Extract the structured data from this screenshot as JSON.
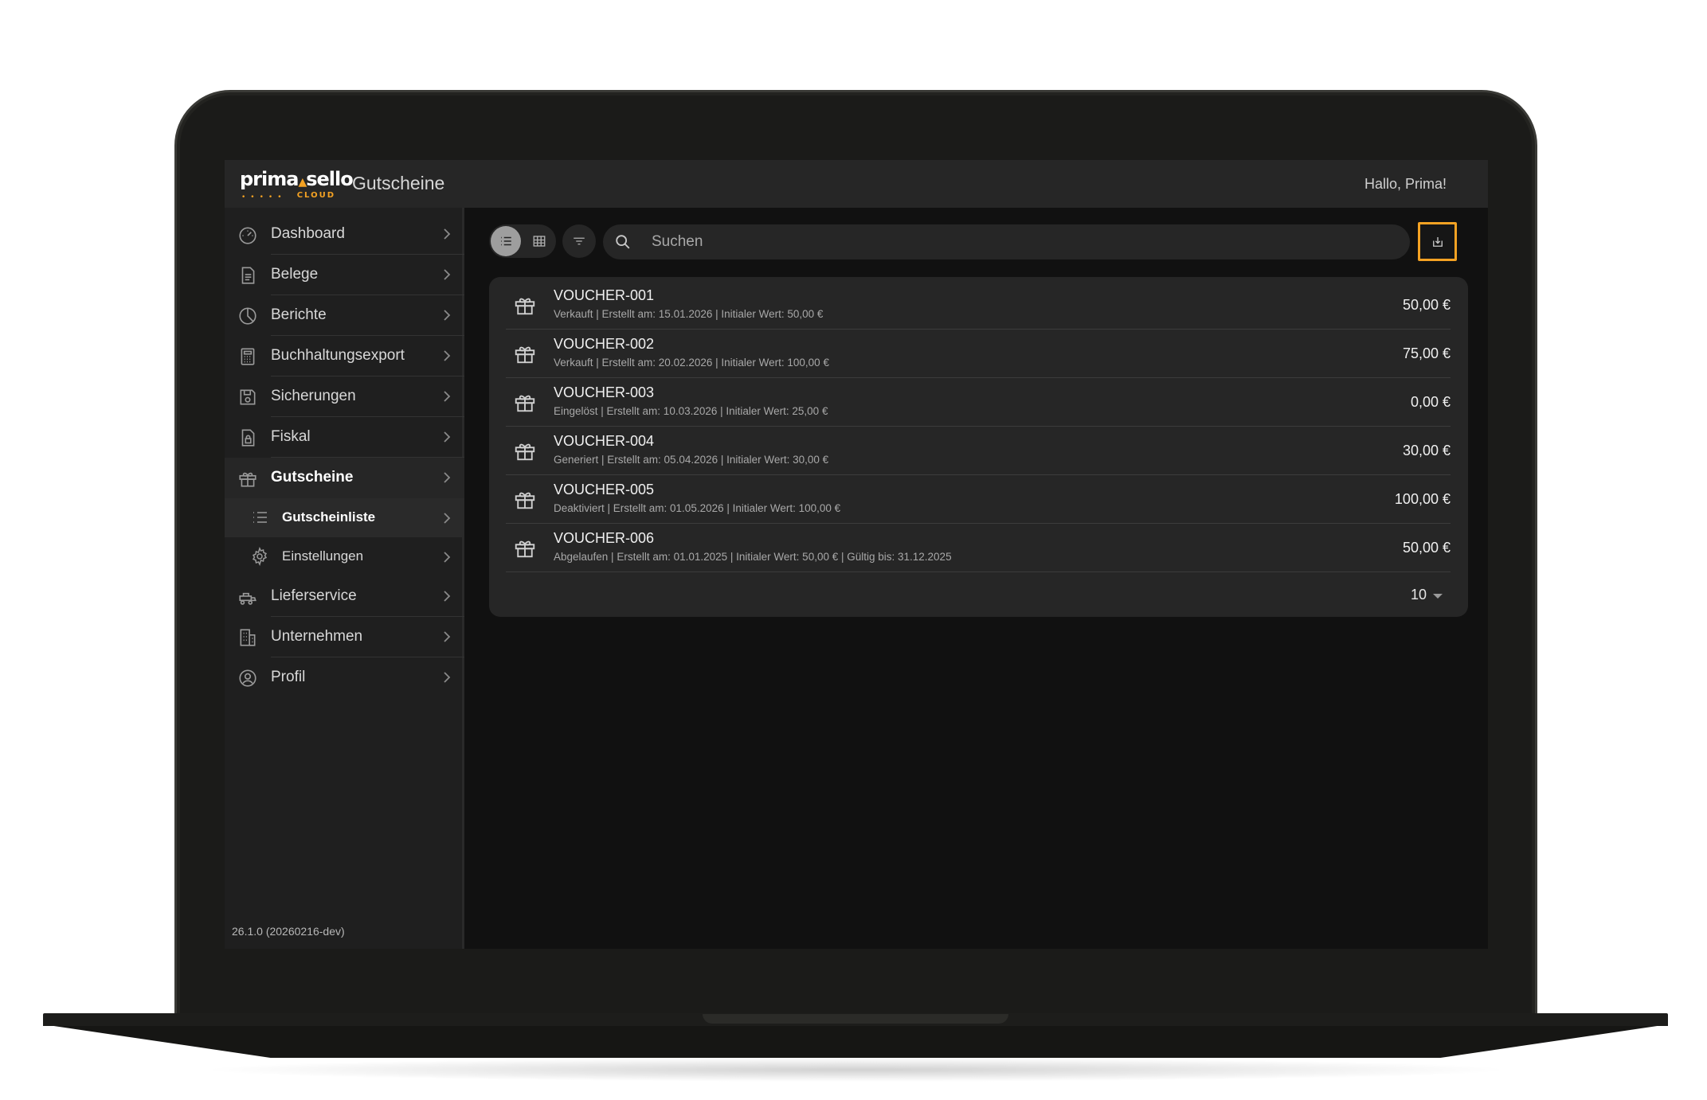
{
  "header": {
    "logo_text_main": "prima",
    "logo_text_accent": "sello",
    "logo_sub": "CLOUD",
    "page_title": "Gutscheine",
    "greeting": "Hallo, Prima!"
  },
  "sidebar": {
    "items": [
      {
        "label": "Dashboard",
        "icon": "gauge-icon"
      },
      {
        "label": "Belege",
        "icon": "document-icon"
      },
      {
        "label": "Berichte",
        "icon": "pie-chart-icon"
      },
      {
        "label": "Buchhaltungsexport",
        "icon": "calculator-icon"
      },
      {
        "label": "Sicherungen",
        "icon": "save-icon"
      },
      {
        "label": "Fiskal",
        "icon": "lock-document-icon"
      },
      {
        "label": "Gutscheine",
        "icon": "gift-icon"
      }
    ],
    "sub_items": [
      {
        "label": "Gutscheinliste",
        "icon": "list-icon"
      },
      {
        "label": "Einstellungen",
        "icon": "gear-icon"
      }
    ],
    "items_after": [
      {
        "label": "Lieferservice",
        "icon": "delivery-icon"
      },
      {
        "label": "Unternehmen",
        "icon": "building-icon"
      },
      {
        "label": "Profil",
        "icon": "user-icon"
      }
    ],
    "version": "26.1.0 (20260216-dev)"
  },
  "toolbar": {
    "search_placeholder": "Suchen",
    "active_view": "list"
  },
  "vouchers": [
    {
      "code": "VOUCHER-001",
      "details": "Verkauft | Erstellt am: 15.01.2026 | Initialer Wert: 50,00 €",
      "amount": "50,00 €"
    },
    {
      "code": "VOUCHER-002",
      "details": "Verkauft | Erstellt am: 20.02.2026 | Initialer Wert: 100,00 €",
      "amount": "75,00 €"
    },
    {
      "code": "VOUCHER-003",
      "details": "Eingelöst | Erstellt am: 10.03.2026 | Initialer Wert: 25,00 €",
      "amount": "0,00 €"
    },
    {
      "code": "VOUCHER-004",
      "details": "Generiert | Erstellt am: 05.04.2026 | Initialer Wert: 30,00 €",
      "amount": "30,00 €"
    },
    {
      "code": "VOUCHER-005",
      "details": "Deaktiviert | Erstellt am: 01.05.2026 | Initialer Wert: 100,00 €",
      "amount": "100,00 €"
    },
    {
      "code": "VOUCHER-006",
      "details": "Abgelaufen | Erstellt am: 01.01.2025 | Initialer Wert: 50,00 € | Gültig bis: 31.12.2025",
      "amount": "50,00 €"
    }
  ],
  "pagination": {
    "page_size": "10"
  },
  "colors": {
    "accent": "#f4a223",
    "background": "#111111",
    "panel": "#262626"
  }
}
